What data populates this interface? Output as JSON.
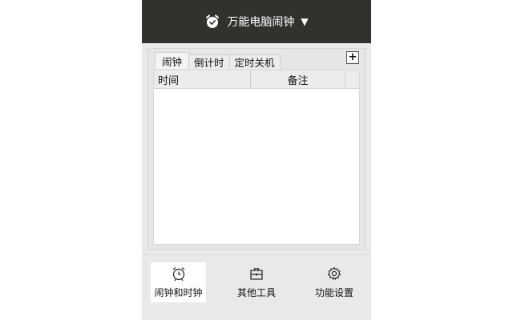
{
  "window": {
    "title": "万能电脑闹钟",
    "title_caret": "▼"
  },
  "tabs": [
    {
      "label": "闹钟",
      "active": true
    },
    {
      "label": "倒计时",
      "active": false
    },
    {
      "label": "定时关机",
      "active": false
    }
  ],
  "add_button": {
    "label": "+"
  },
  "table": {
    "columns": [
      "时间",
      "备注"
    ],
    "rows": []
  },
  "bottom_nav": [
    {
      "label": "闹钟和时钟",
      "icon": "alarm-clock-icon",
      "active": true
    },
    {
      "label": "其他工具",
      "icon": "toolbox-icon",
      "active": false
    },
    {
      "label": "功能设置",
      "icon": "gear-icon",
      "active": false
    }
  ],
  "colors": {
    "titlebar_bg": "#33312e",
    "panel_bg": "#e9e9e9",
    "active_nav_bg": "#ffffff"
  }
}
